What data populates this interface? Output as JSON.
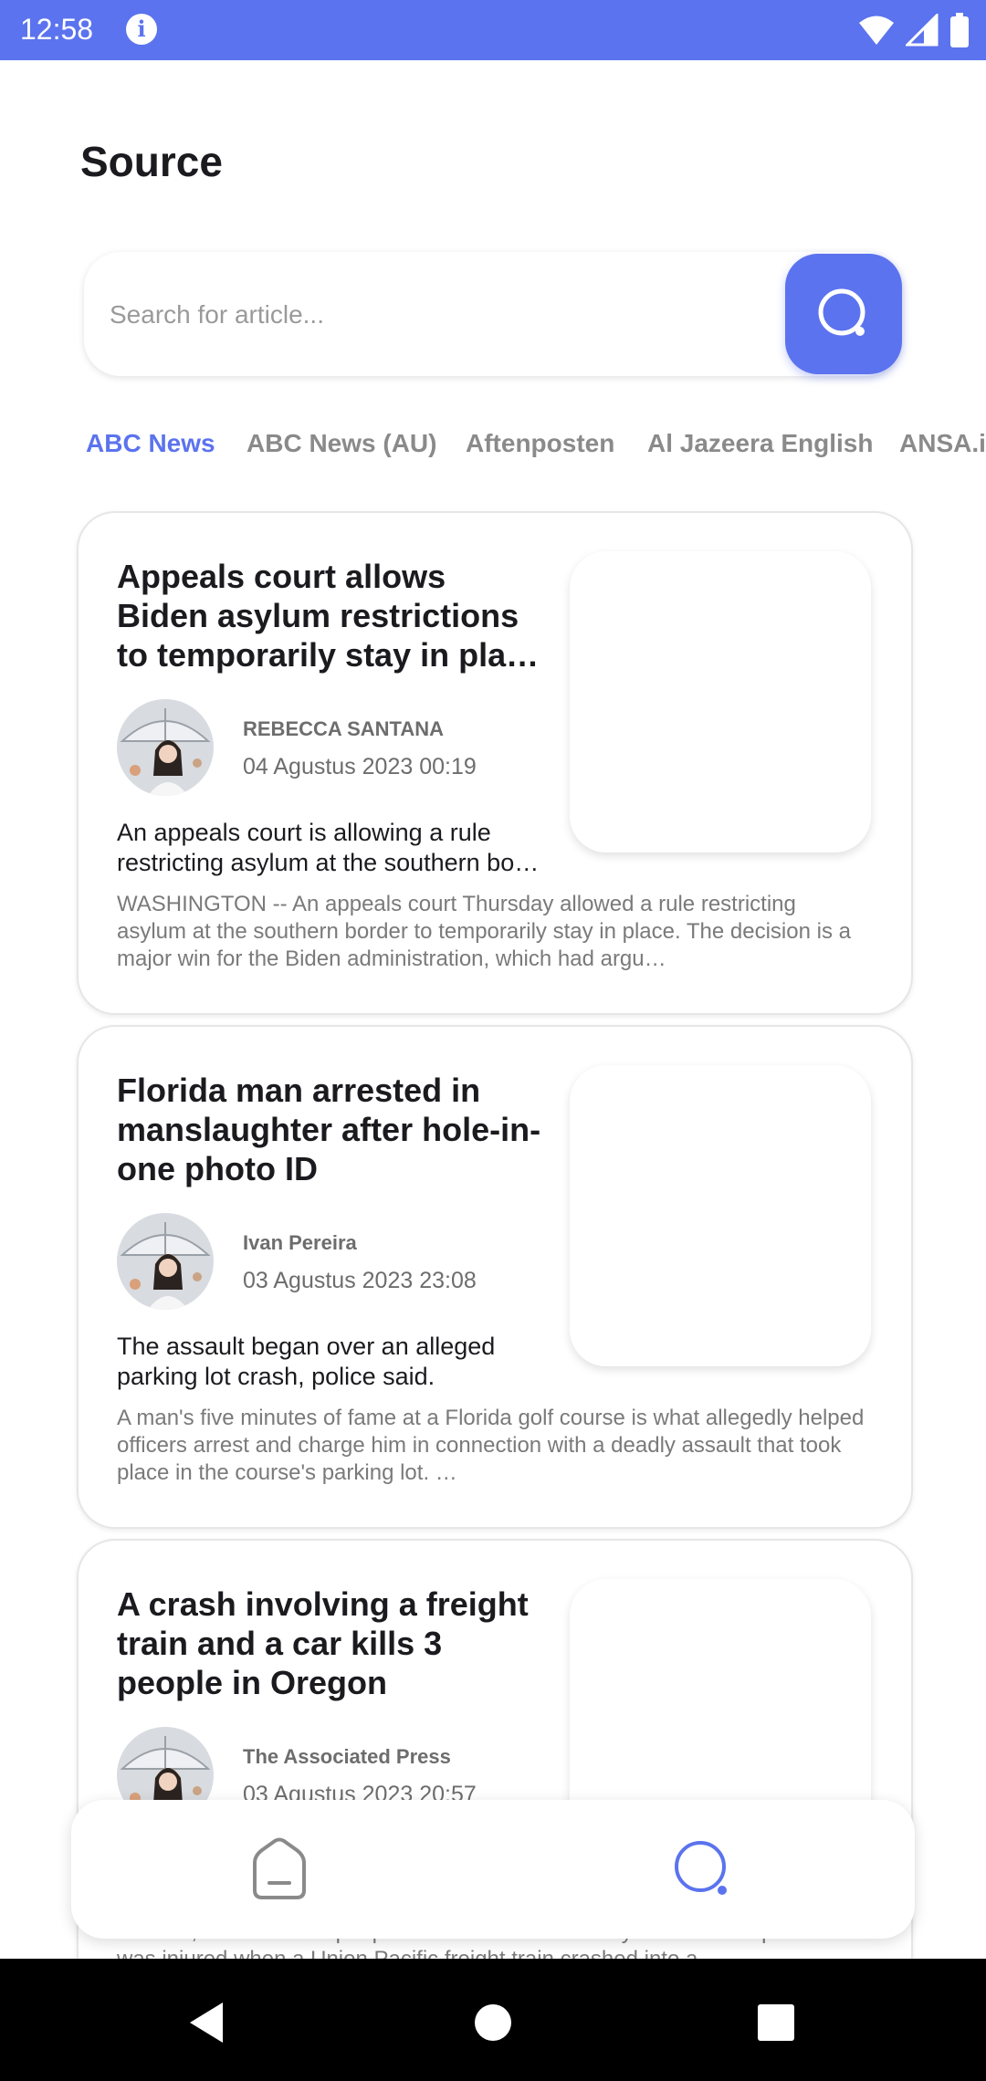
{
  "status": {
    "time": "12:58"
  },
  "page": {
    "title": "Source"
  },
  "search": {
    "placeholder": "Search for article..."
  },
  "tabs": [
    {
      "label": "ABC News",
      "active": true
    },
    {
      "label": "ABC News (AU)",
      "active": false
    },
    {
      "label": "Aftenposten",
      "active": false
    },
    {
      "label": "Al Jazeera English",
      "active": false
    },
    {
      "label": "ANSA.it",
      "active": false
    }
  ],
  "articles": [
    {
      "title": "Appeals court allows Biden asylum restrictions to temporarily stay in place a…",
      "author": "REBECCA SANTANA",
      "date": "04 Agustus 2023 00:19",
      "description": "An appeals court is allowing a rule restricting asylum at the southern bo…",
      "content": "WASHINGTON -- An appeals court Thursday allowed a rule restricting asylum at the southern border to temporarily stay in place. The decision is a major win for the Biden administration, which had argu…"
    },
    {
      "title": "Florida man arrested in manslaughter after hole-in-one photo ID",
      "author": "Ivan Pereira",
      "date": "03 Agustus 2023 23:08",
      "description": "The assault began over an alleged parking lot crash, police said.",
      "content": "A man's five minutes of fame at a Florida golf course is what allegedly helped officers arrest and charge him in connection with a deadly assault that took place in the course's parking lot. …"
    },
    {
      "title": "A crash involving a freight train and a car kills 3 people in Oregon",
      "author": "The Associated Press",
      "date": "03 Agustus 2023 20:57",
      "description": "",
      "content": "SALEM, Ore. -- Three people were killed Wednesday and another person was injured when a Union Pacific freight train crashed into a…"
    }
  ],
  "bottom_nav": {
    "items": [
      "home-icon",
      "search-icon"
    ],
    "active": "search-icon"
  },
  "colors": {
    "accent": "#5b73ee",
    "statusbar": "#5b73ee"
  }
}
